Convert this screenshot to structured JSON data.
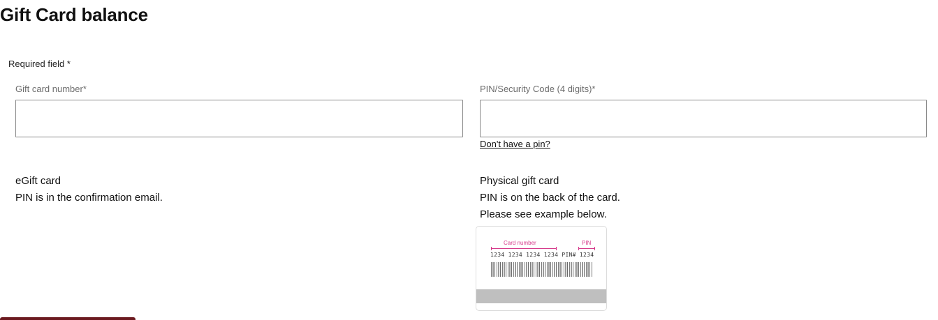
{
  "page": {
    "title": "Gift Card balance",
    "required_note": "Required field *"
  },
  "form": {
    "card_number": {
      "label": "Gift card number*",
      "value": "",
      "placeholder": ""
    },
    "pin": {
      "label": "PIN/Security Code (4 digits)*",
      "value": "",
      "placeholder": "",
      "help_link": "Don't have a pin?"
    }
  },
  "egift": {
    "title": "eGift card",
    "description": "PIN is in the confirmation email."
  },
  "physical": {
    "title": "Physical gift card",
    "description": "PIN is on the back of the card.",
    "example_note": "Please see example below."
  },
  "card_example": {
    "card_number_label": "Card number",
    "pin_label": "PIN",
    "digits": "1234 1234 1234 1234  PIN# 1234",
    "accent_color": "#d63a8b"
  },
  "colors": {
    "button_brand": "#6b1a1f"
  }
}
